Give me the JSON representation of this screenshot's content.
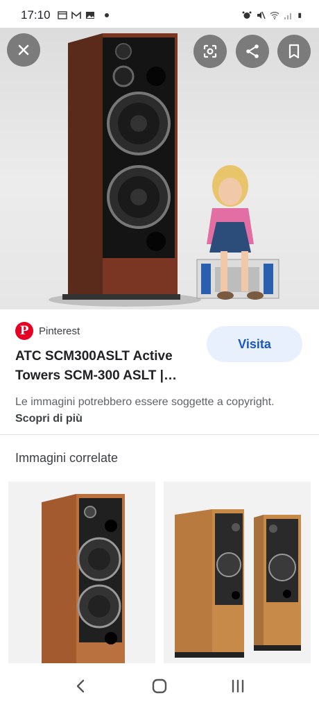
{
  "status_bar": {
    "time": "17:10",
    "left_icons": [
      "calendar-icon",
      "gmail-icon",
      "gallery-icon",
      "notification-dot-icon"
    ],
    "right_icons": [
      "alarm-icon",
      "mute-icon",
      "wifi-icon",
      "signal-icon",
      "battery-icon"
    ]
  },
  "hero": {
    "buttons": [
      "close-icon",
      "lens-icon",
      "share-icon",
      "bookmark-icon"
    ]
  },
  "result": {
    "source": "Pinterest",
    "title": "ATC SCM300ASLT Active Towers SCM-300 ASLT |…",
    "visit_label": "Visita",
    "copyright_text": "Le immagini potrebbero essere soggette a copyright.",
    "copyright_link": "Scopri di più"
  },
  "related": {
    "title": "Immagini correlate"
  },
  "nav": {
    "buttons": [
      "back-icon",
      "home-icon",
      "recents-icon"
    ]
  },
  "colors": {
    "accent": "#1a56c4",
    "visit_bg": "#e8f0fe",
    "pinterest": "#e60023"
  }
}
